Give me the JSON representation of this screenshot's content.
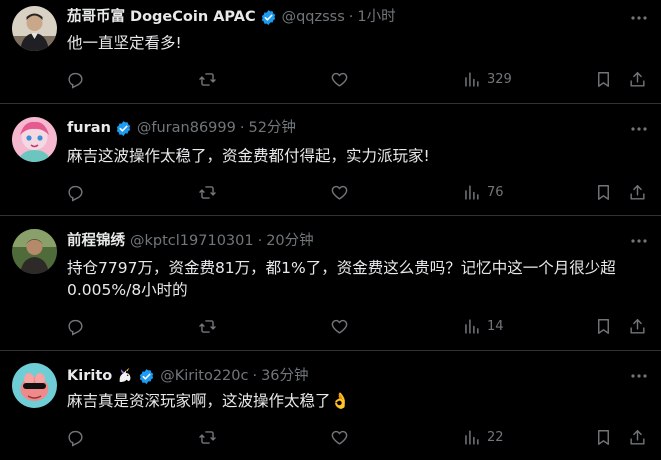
{
  "tweets": [
    {
      "display_name": "茄哥币富 DogeCoin APAC",
      "handle": "@qqzsss",
      "separator": "·",
      "time": "1小时",
      "text": "他一直坚定看多!",
      "views": "329",
      "verified": true,
      "avatar": "portrait-icon"
    },
    {
      "display_name": "furan",
      "handle": "@furan86999",
      "separator": "·",
      "time": "52分钟",
      "text": "麻吉这波操作太稳了，资金费都付得起，实力派玩家!",
      "views": "76",
      "verified": true,
      "avatar": "anime-avatar-icon"
    },
    {
      "display_name": "前程锦绣",
      "handle": "@kptcl19710301",
      "separator": "·",
      "time": "20分钟",
      "text": "持仓7797万，资金费81万，都1%了，资金费这么贵吗？记忆中这一个月很少超0.005%/8小时的",
      "views": "14",
      "verified": false,
      "avatar": "photo-avatar-icon"
    },
    {
      "display_name": "Kirito",
      "handle": "@Kirito220c",
      "separator": "·",
      "time": "36分钟",
      "text": "麻吉真是资深玩家啊，这波操作太稳了👌",
      "views": "22",
      "verified": true,
      "avatar": "cartoon-avatar-icon",
      "name_emoji": "unicorn-icon"
    }
  ],
  "colors": {
    "background": "#000000",
    "text": "#e7e9ea",
    "muted": "#71767b",
    "verified": "#1d9bf0",
    "divider": "#2f3336"
  }
}
